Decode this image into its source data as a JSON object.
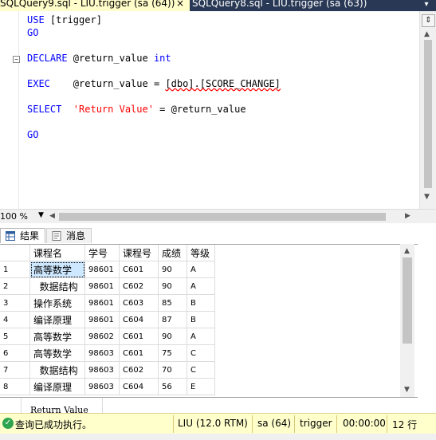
{
  "tabs": {
    "active_label": "SQLQuery9.sql - LIU.trigger (sa (64))",
    "active_close": "×",
    "inactive_label": "SQLQuery8.sql - LIU.trigger (sa (63))",
    "menu_glyph": "▾"
  },
  "editor": {
    "line1_kw": "USE",
    "line1_rest": " [trigger]",
    "line2_kw": "GO",
    "line3_kw": "DECLARE",
    "line3_var": " @return_value ",
    "line3_type": "int",
    "line4_kw": "EXEC",
    "line4_var": "    @return_value = ",
    "line4_proc": "[dbo].[SCORE_CHANGE]",
    "line5_kw": "SELECT",
    "line5_str": "  'Return Value'",
    "line5_rest": " = @return_value",
    "line6_kw": "GO",
    "collapse_glyph": "−"
  },
  "scroll": {
    "split_glyph": "⇕",
    "up": "▲",
    "down": "▼",
    "left": "◀",
    "right": "▶"
  },
  "zoom": {
    "value": "100 %",
    "arrow": "▼"
  },
  "result_tabs": {
    "results": "结果",
    "messages": "消息"
  },
  "grid": {
    "headers": [
      "课程名",
      "学号",
      "课程号",
      "成绩",
      "等级"
    ],
    "rows": [
      {
        "n": "1",
        "c": [
          "高等数学",
          "98601",
          "C601",
          "90",
          "A"
        ]
      },
      {
        "n": "2",
        "c": [
          "  数据结构",
          "98601",
          "C602",
          "90",
          "A"
        ]
      },
      {
        "n": "3",
        "c": [
          "操作系统",
          "98601",
          "C603",
          "85",
          "B"
        ]
      },
      {
        "n": "4",
        "c": [
          "编译原理",
          "98601",
          "C604",
          "87",
          "B"
        ]
      },
      {
        "n": "5",
        "c": [
          "高等数学",
          "98602",
          "C601",
          "90",
          "A"
        ]
      },
      {
        "n": "6",
        "c": [
          "高等数学",
          "98603",
          "C601",
          "75",
          "C"
        ]
      },
      {
        "n": "7",
        "c": [
          "  数据结构",
          "98603",
          "C602",
          "70",
          "C"
        ]
      },
      {
        "n": "8",
        "c": [
          "编译原理",
          "98603",
          "C604",
          "56",
          "E"
        ]
      }
    ]
  },
  "return_value_header": "Return Value",
  "status": {
    "message": "查询已成功执行。",
    "server": "LIU (12.0 RTM)",
    "user": "sa (64)",
    "database": "trigger",
    "elapsed": "00:00:00",
    "rows": "12 行"
  }
}
